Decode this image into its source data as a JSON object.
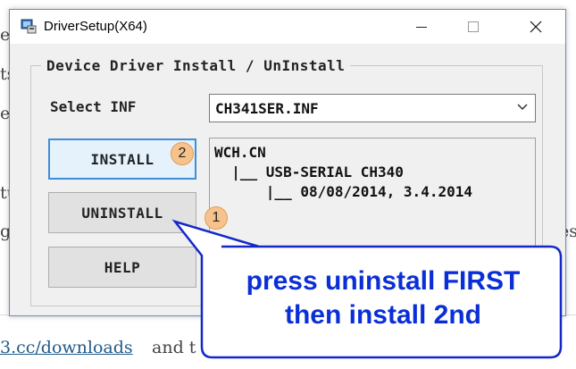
{
  "window": {
    "title": "DriverSetup(X64)",
    "group_label": "Device Driver Install / UnInstall",
    "select_inf_label": "Select INF",
    "select_inf_value": "CH341SER.INF",
    "buttons": {
      "install": "INSTALL",
      "uninstall": "UNINSTALL",
      "help": "HELP"
    },
    "info": {
      "line1": "WCH.CN",
      "line2": "  |__ USB-SERIAL CH340",
      "line3": "      |__ 08/08/2014, 3.4.2014"
    }
  },
  "annotations": {
    "badge_install": "2",
    "badge_uninstall": "1",
    "callout_line1": "press uninstall FIRST",
    "callout_line2": "then install 2nd"
  },
  "background_page": {
    "fragments_left": [
      "ei",
      "ts",
      "e",
      "tu",
      "ge"
    ],
    "fragment_right": "es",
    "link_text": "3.cc/downloads",
    "after_link_text": "and t"
  },
  "colors": {
    "callout_text": "#0a2fd6",
    "callout_border": "#1428c8",
    "badge_fill": "#f7c38c",
    "focus_border": "#3c8fd8"
  }
}
